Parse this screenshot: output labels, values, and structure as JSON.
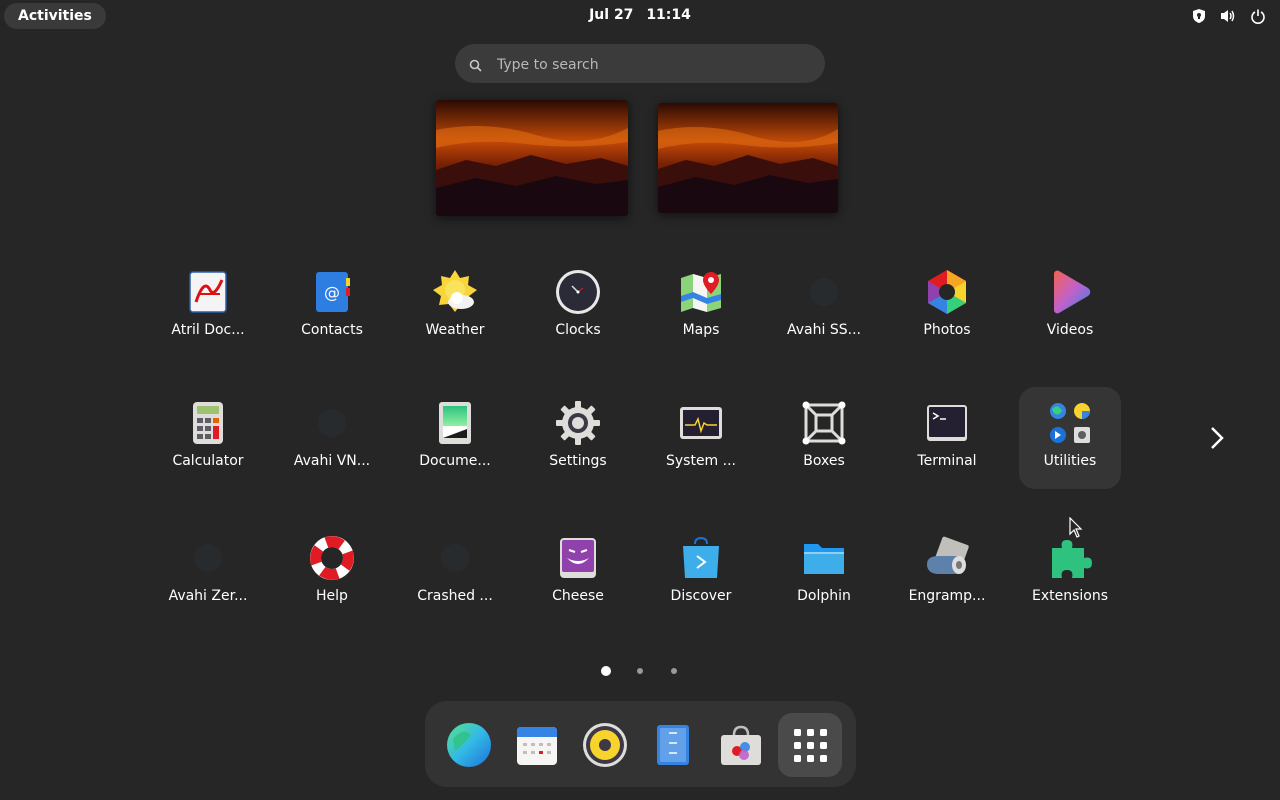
{
  "topbar": {
    "activities_label": "Activities",
    "date": "Jul 27",
    "time": "11:14"
  },
  "search": {
    "placeholder": "Type to search",
    "value": ""
  },
  "apps": [
    {
      "label": "Atril Doc...",
      "icon": "atril-icon"
    },
    {
      "label": "Contacts",
      "icon": "contacts-icon"
    },
    {
      "label": "Weather",
      "icon": "weather-icon"
    },
    {
      "label": "Clocks",
      "icon": "clocks-icon"
    },
    {
      "label": "Maps",
      "icon": "maps-icon"
    },
    {
      "label": "Avahi SS...",
      "icon": "avahi-ssh-icon"
    },
    {
      "label": "Photos",
      "icon": "photos-icon"
    },
    {
      "label": "Videos",
      "icon": "videos-icon"
    },
    {
      "label": "Calculator",
      "icon": "calculator-icon"
    },
    {
      "label": "Avahi VN...",
      "icon": "avahi-vnc-icon"
    },
    {
      "label": "Docume...",
      "icon": "document-scanner-icon"
    },
    {
      "label": "Settings",
      "icon": "settings-icon"
    },
    {
      "label": "System ...",
      "icon": "system-monitor-icon"
    },
    {
      "label": "Boxes",
      "icon": "boxes-icon"
    },
    {
      "label": "Terminal",
      "icon": "terminal-icon"
    },
    {
      "label": "Utilities",
      "icon": "utilities-folder-icon"
    },
    {
      "label": "Avahi Zer...",
      "icon": "avahi-zeroconf-icon"
    },
    {
      "label": "Help",
      "icon": "help-icon"
    },
    {
      "label": "Crashed ...",
      "icon": "crashed-processes-icon"
    },
    {
      "label": "Cheese",
      "icon": "cheese-icon"
    },
    {
      "label": "Discover",
      "icon": "discover-icon"
    },
    {
      "label": "Dolphin",
      "icon": "dolphin-icon"
    },
    {
      "label": "Engramp...",
      "icon": "engrampa-icon"
    },
    {
      "label": "Extensions",
      "icon": "extensions-icon"
    }
  ],
  "pages": {
    "current": 1,
    "total": 3
  },
  "dock": [
    {
      "icon": "web-browser-icon"
    },
    {
      "icon": "calendar-icon"
    },
    {
      "icon": "rhythmbox-icon"
    },
    {
      "icon": "files-icon"
    },
    {
      "icon": "software-icon"
    },
    {
      "icon": "show-apps-icon"
    }
  ],
  "colors": {
    "background": "#262626",
    "selected_tile": "#353535",
    "dock": "#333333"
  }
}
